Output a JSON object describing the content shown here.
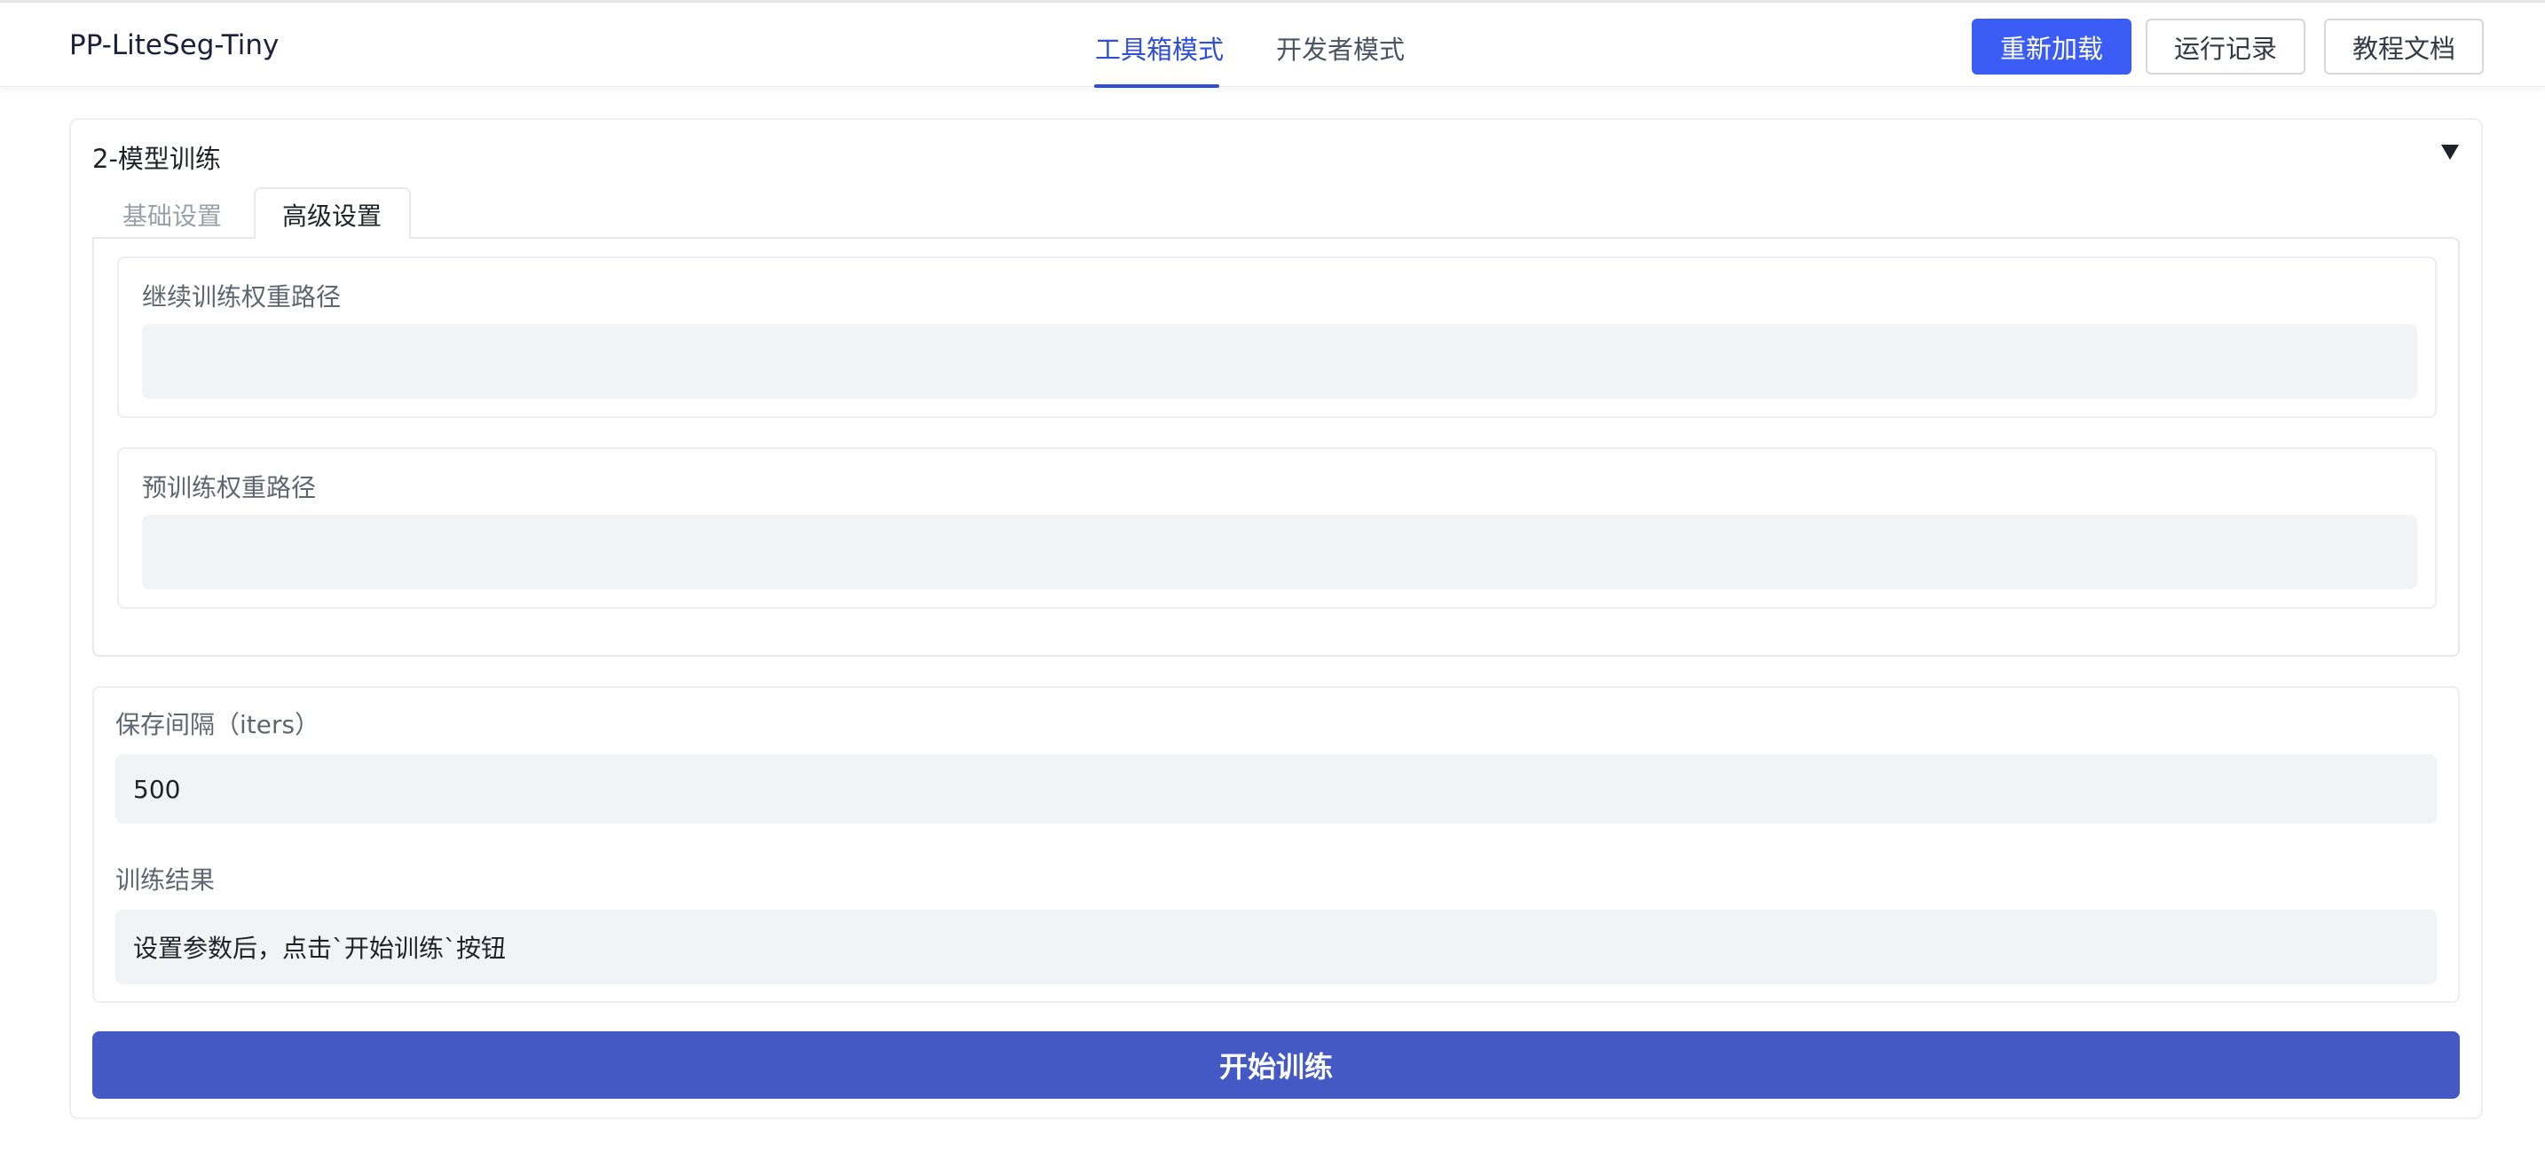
{
  "header": {
    "app_title": "PP-LiteSeg-Tiny",
    "tabs": [
      {
        "label": "工具箱模式",
        "active": true
      },
      {
        "label": "开发者模式",
        "active": false
      }
    ],
    "buttons": {
      "reload": "重新加载",
      "run_log": "运行记录",
      "docs": "教程文档"
    }
  },
  "panel": {
    "title": "2-模型训练",
    "collapse_icon": "triangle-down-icon",
    "sub_tabs": [
      {
        "label": "基础设置",
        "active": false
      },
      {
        "label": "高级设置",
        "active": true
      }
    ],
    "advanced": {
      "resume_weights": {
        "label": "继续训练权重路径",
        "value": ""
      },
      "pretrained_weights": {
        "label": "预训练权重路径",
        "value": ""
      }
    },
    "save_interval": {
      "label": "保存间隔（iters）",
      "value": "500"
    },
    "train_result": {
      "label": "训练结果",
      "value": "设置参数后，点击`开始训练`按钮"
    },
    "start_button": "开始训练"
  },
  "colors": {
    "accent": "#2f4fd9",
    "primary_button": "#3b5cf5",
    "train_button": "#4459c4",
    "input_bg": "#f2f3f5"
  }
}
